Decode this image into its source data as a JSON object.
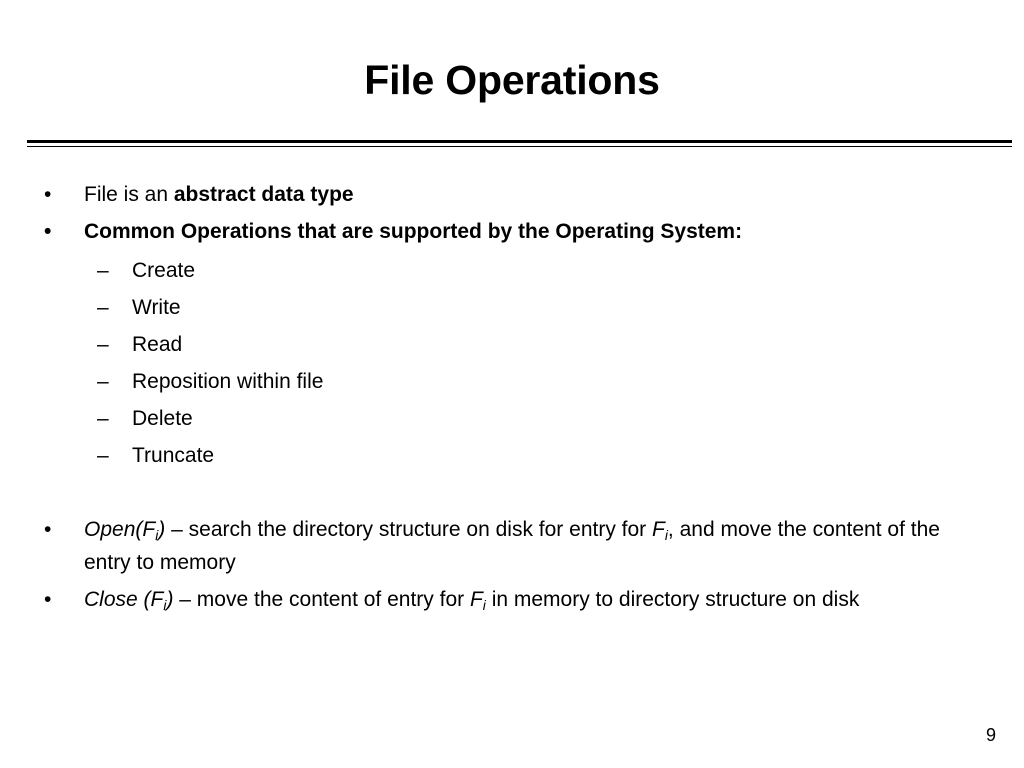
{
  "slide": {
    "title": "File Operations",
    "page_number": "9",
    "bullet_marker": "•",
    "dash_marker": "–",
    "background_color": "#ffffff",
    "text_color": "#000000"
  },
  "bullets": [
    {
      "text_plain": "File is an ",
      "text_bold": "abstract data type"
    },
    {
      "text_plain": "",
      "text_bold": "Common Operations that are supported by the Operating System:"
    }
  ],
  "sub_bullets": [
    {
      "label": "Create"
    },
    {
      "label": "Write"
    },
    {
      "label": "Read"
    },
    {
      "label": "Reposition within file"
    },
    {
      "label": "Delete"
    },
    {
      "label": "Truncate"
    }
  ],
  "paragraphs": [
    {
      "term": "Open(F",
      "term_sub": "i",
      "term_tail": ")",
      "body_before": " – search the directory structure on disk for entry for  ",
      "var": "F",
      "var_sub": "i",
      "body_after": ", and move the content of the entry to memory"
    },
    {
      "term": "Close (F",
      "term_sub": "i",
      "term_tail": ")",
      "body_before": " – move the content of entry for  ",
      "var": "F",
      "var_sub": "i",
      "body_after": " in memory to directory structure on disk"
    }
  ]
}
